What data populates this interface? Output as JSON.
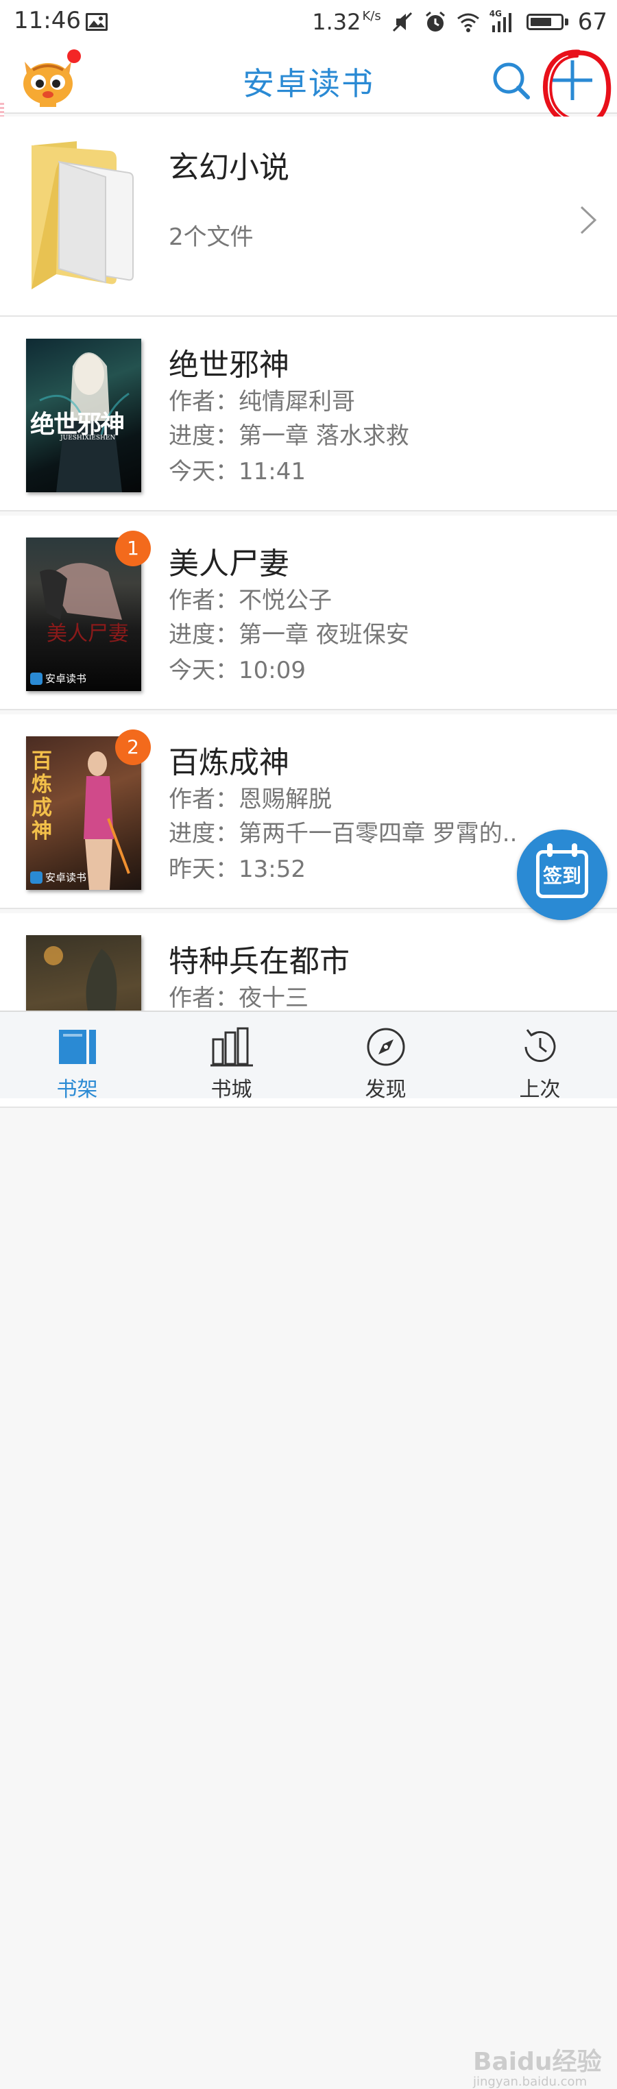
{
  "status_bar": {
    "time": "11:46",
    "speed": "1.32",
    "speed_unit": "K/s",
    "network": "4G",
    "battery": "67"
  },
  "app_bar": {
    "title": "安卓读书"
  },
  "folder": {
    "name": "玄幻小说",
    "count": "2个文件"
  },
  "books": [
    {
      "title": "绝世邪神",
      "author": "作者：纯情犀利哥",
      "progress": "进度：第一章 落水求救",
      "time": "今天：11:41",
      "badge": "",
      "cover_text": "绝世邪神",
      "cover_sub": "JUESHIXIESHEN"
    },
    {
      "title": "美人尸妻",
      "author": "作者：不悦公子",
      "progress": "进度：第一章 夜班保安",
      "time": "今天：10:09",
      "badge": "1",
      "cover_logo": "安卓读书"
    },
    {
      "title": "百炼成神",
      "author": "作者：恩赐解脱",
      "progress": "进度：第两千一百零四章 罗霄的..",
      "time": "昨天：13:52",
      "badge": "2",
      "cover_text": "百炼成神",
      "cover_logo": "安卓读书"
    },
    {
      "title": "特种兵在都市",
      "author": "作者：夜十三"
    }
  ],
  "fab": {
    "label": "签到"
  },
  "tabs": [
    {
      "label": "书架",
      "icon": "bookshelf-icon",
      "active": true
    },
    {
      "label": "书城",
      "icon": "bookstore-icon",
      "active": false
    },
    {
      "label": "发现",
      "icon": "compass-icon",
      "active": false
    },
    {
      "label": "上次",
      "icon": "history-icon",
      "active": false
    }
  ],
  "watermark": {
    "text": "Baidu经验",
    "url": "jingyan.baidu.com"
  },
  "colors": {
    "accent": "#2a8ad4",
    "badge": "#f36a1c",
    "annotation": "#e8101a"
  }
}
